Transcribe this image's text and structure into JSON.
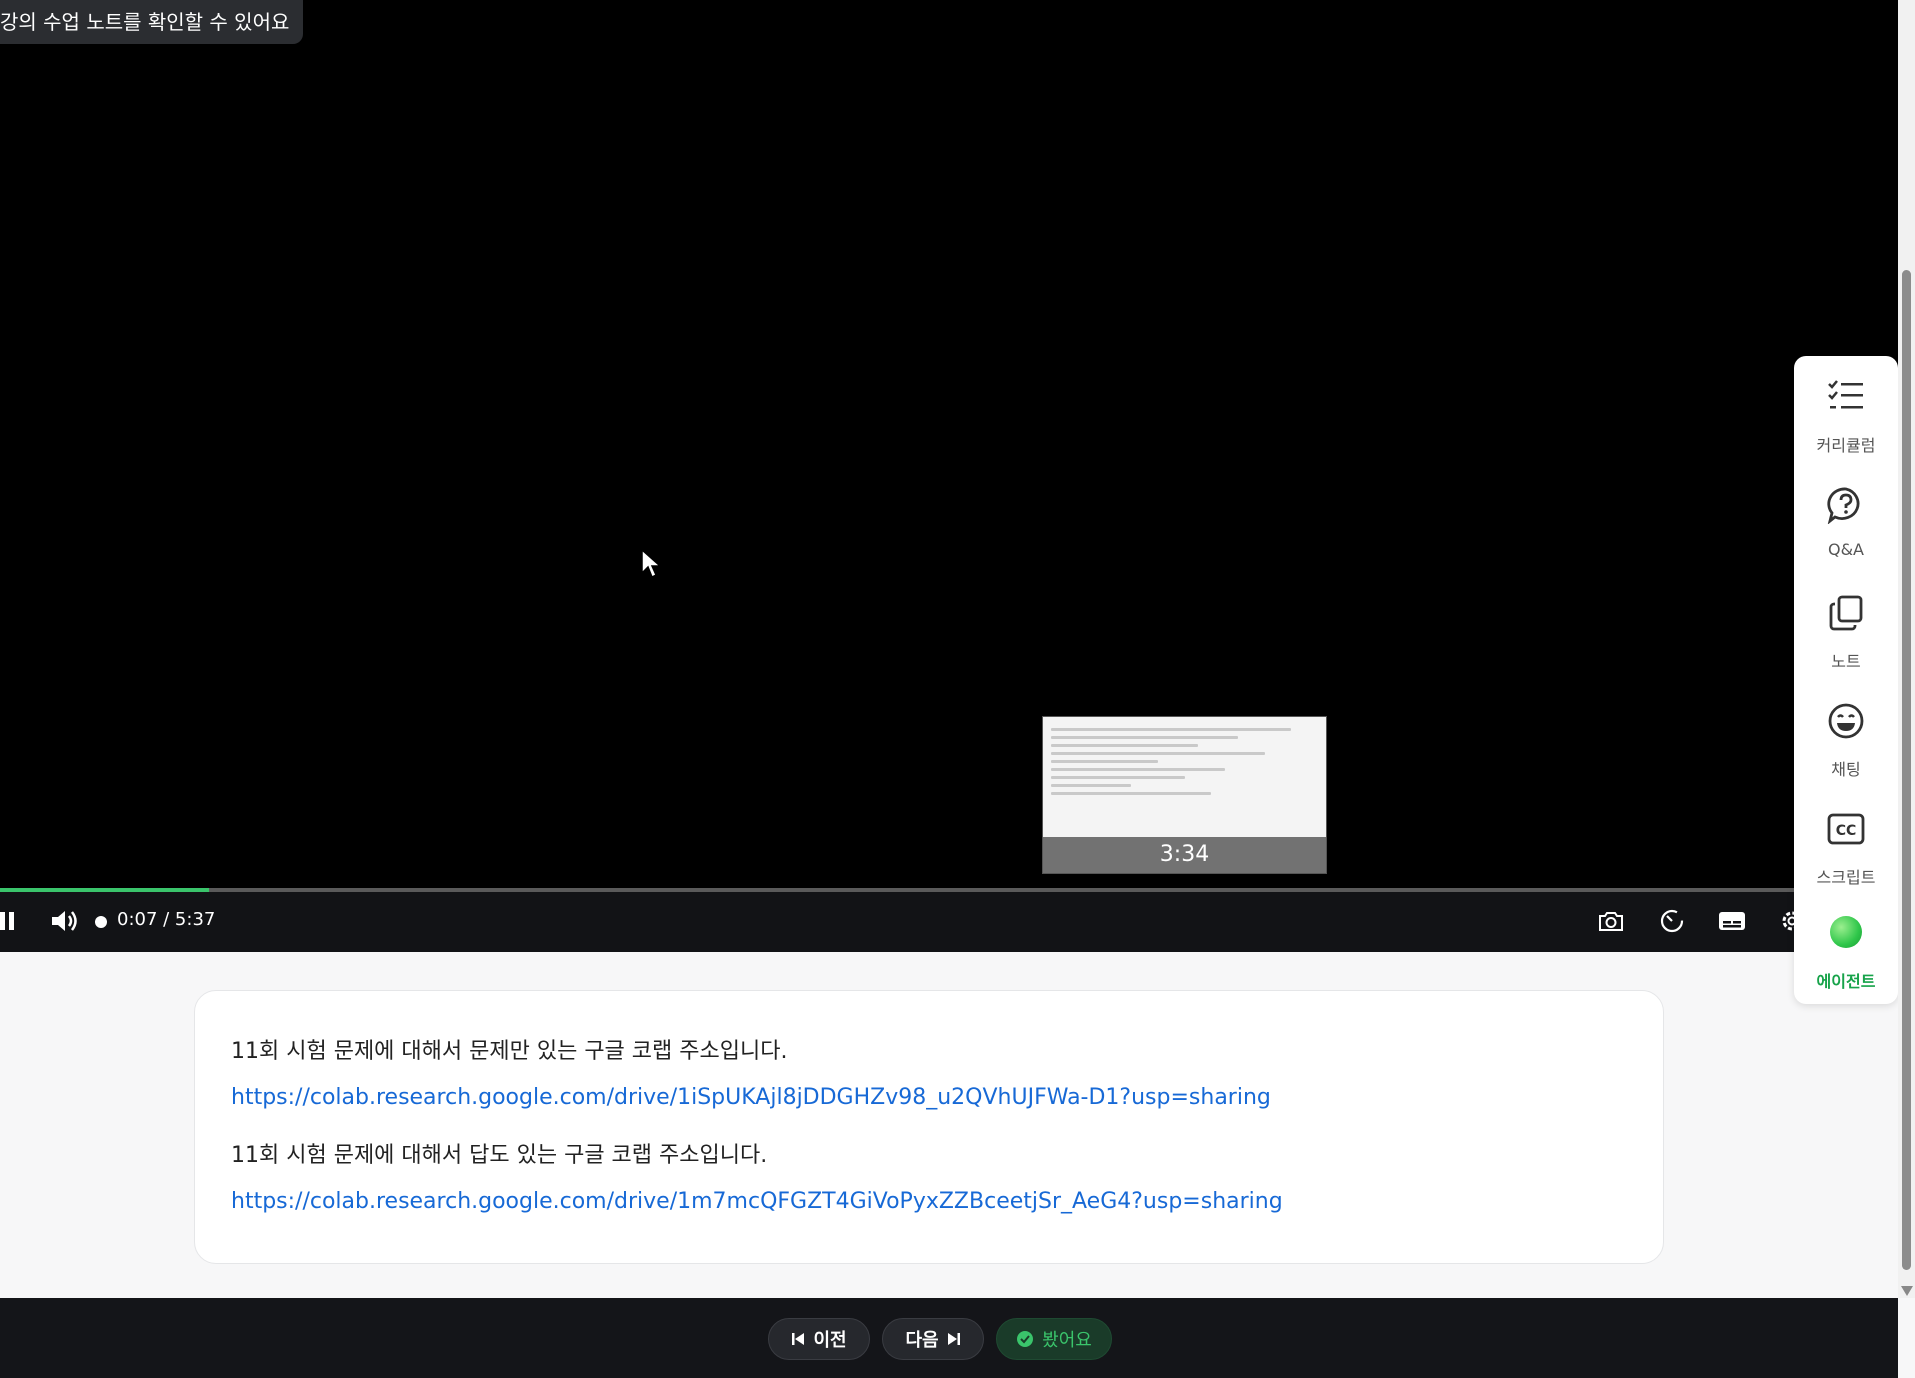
{
  "toast": {
    "text": "강의 수업 노트를 확인할 수 있어요"
  },
  "player": {
    "preview_time": "3:34",
    "time_display": "0:07 / 5:37",
    "progress_fraction": 0.11
  },
  "rail": {
    "items": [
      {
        "label": "커리큘럼",
        "icon": "curriculum-icon"
      },
      {
        "label": "Q&A",
        "icon": "question-icon"
      },
      {
        "label": "노트",
        "icon": "note-icon"
      },
      {
        "label": "채팅",
        "icon": "chat-icon"
      },
      {
        "label": "스크립트",
        "icon": "cc-icon"
      },
      {
        "label": "에이전트",
        "icon": "agent-icon"
      }
    ],
    "accent": "#17a34a"
  },
  "note": {
    "line1": "11회 시험 문제에 대해서 문제만 있는 구글 코랩 주소입니다.",
    "link1": "https://colab.research.google.com/drive/1iSpUKAjl8jDDGHZv98_u2QVhUJFWa-D1?usp=sharing",
    "line2": "11회 시험 문제에 대해서 답도 있는 구글 코랩 주소입니다.",
    "link2": "https://colab.research.google.com/drive/1m7mcQFGZT4GiVoPyxZZBceetjSr_AeG4?usp=sharing"
  },
  "nav": {
    "prev_label": "이전",
    "next_label": "다음",
    "done_label": "봤어요"
  },
  "colors": {
    "progress": "#3ac46b",
    "link": "#1769d6"
  }
}
